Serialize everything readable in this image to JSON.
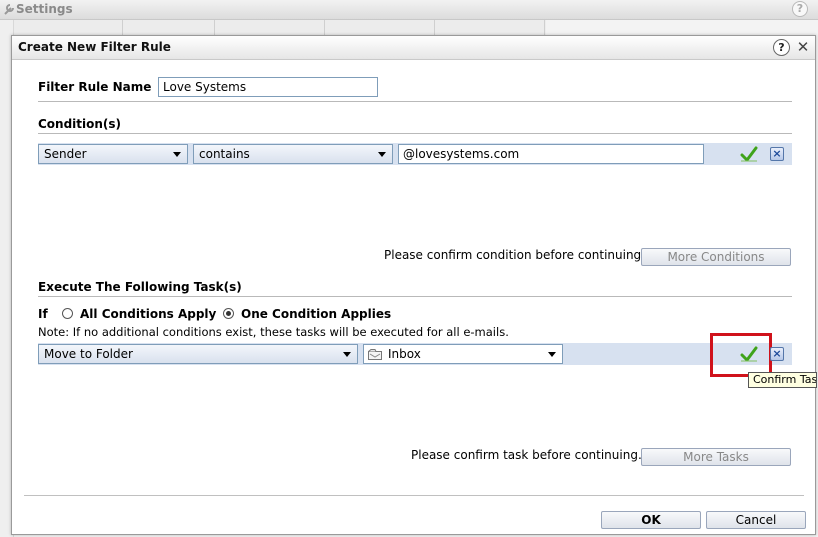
{
  "background": {
    "title": "Settings",
    "help_glyph": "?"
  },
  "dialog": {
    "title": "Create New Filter Rule",
    "help_glyph": "?",
    "close_glyph": "✕"
  },
  "name_section": {
    "label": "Filter Rule Name",
    "value": "Love Systems"
  },
  "conditions": {
    "heading": "Condition(s)",
    "row": {
      "field": "Sender",
      "operator": "contains",
      "value": "@lovesystems.com"
    },
    "message": "Please confirm condition before continuing.",
    "more_button": "More Conditions"
  },
  "tasks": {
    "heading": "Execute The Following Task(s)",
    "if_label": "If",
    "option_all": "All Conditions Apply",
    "option_one": "One Condition Applies",
    "selected_option": "one",
    "note": "Note: If no additional conditions exist, these tasks will be executed for all e-mails.",
    "row": {
      "action": "Move to Folder",
      "folder": "Inbox"
    },
    "tooltip": "Confirm Task",
    "message": "Please confirm task before continuing.",
    "more_button": "More Tasks"
  },
  "footer": {
    "ok_label": "OK",
    "cancel_label": "Cancel"
  },
  "colors": {
    "row_band": "#d7e1f0",
    "highlight": "#d0121b",
    "check_green": "#3fa31a"
  }
}
